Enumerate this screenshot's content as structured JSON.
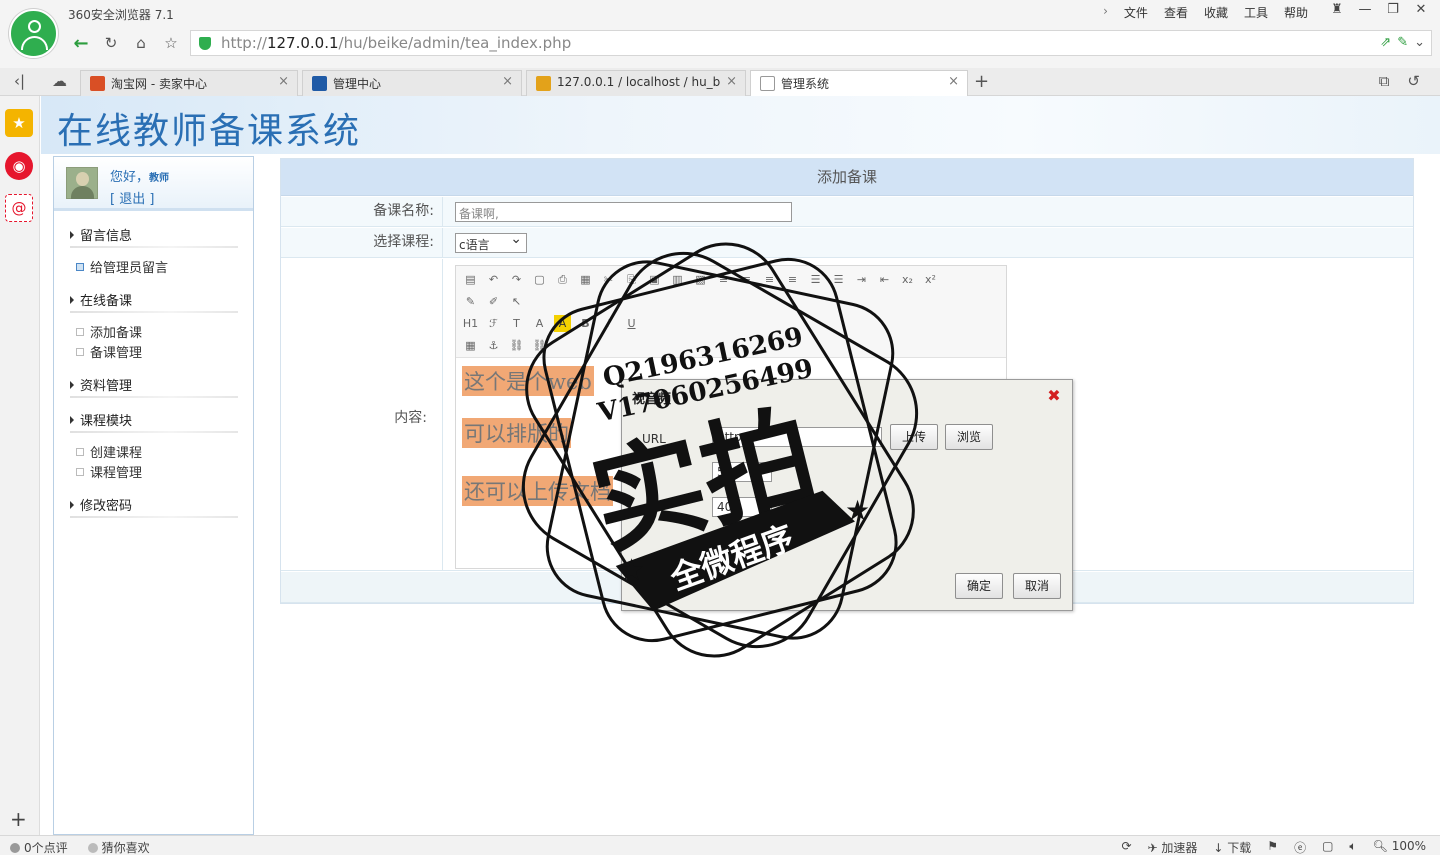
{
  "browser": {
    "app_title": "360安全浏览器 7.1",
    "menu": [
      "文件",
      "查看",
      "收藏",
      "工具",
      "帮助"
    ],
    "url_prefix": "http://",
    "url_host": "127.0.0.1",
    "url_path": "/hu/beike/admin/tea_index.php",
    "tabs": [
      {
        "label": "淘宝网 - 卖家中心",
        "icon_color": "#d94f25"
      },
      {
        "label": "管理中心",
        "icon_color": "#1f5aa6"
      },
      {
        "label": "127.0.0.1 / localhost / hu_b",
        "icon_color": "#e3a21a"
      },
      {
        "label": "管理系统",
        "icon_color": "#ffffff"
      }
    ]
  },
  "page": {
    "title": "在线教师备课系统",
    "user": {
      "greeting": "您好，",
      "role": "教师",
      "logout": "[ 退出 ]"
    },
    "menu": {
      "group1": "留言信息",
      "item1": "给管理员留言",
      "group2": "在线备课",
      "item2": "添加备课",
      "item3": "备课管理",
      "group3": "资料管理",
      "group4": "课程模块",
      "item4": "创建课程",
      "item5": "课程管理",
      "group5": "修改密码"
    },
    "form": {
      "heading": "添加备课",
      "name_label": "备课名称:",
      "name_value": "备课啊,",
      "course_label": "选择课程:",
      "course_value": "c语言",
      "content_label": "内容:",
      "content_lines": [
        "这个是个web",
        "可以排版的",
        "还可以上传文档"
      ]
    },
    "dialog": {
      "title": "视音频",
      "url_value": "http",
      "width_value": "550",
      "height_value": "400",
      "upload_btn": "上传",
      "browse_btn": "浏览",
      "ok_btn": "确定",
      "cancel_btn": "取消"
    }
  },
  "watermark": {
    "qq": "Q2196316269",
    "wechat": "V17060256499",
    "big": "实拍",
    "banner": "全微程序"
  },
  "status": {
    "comments": "0个点评",
    "guess": "猜你喜欢",
    "accelerator": "加速器",
    "download": "下载",
    "zoom": "100%"
  }
}
